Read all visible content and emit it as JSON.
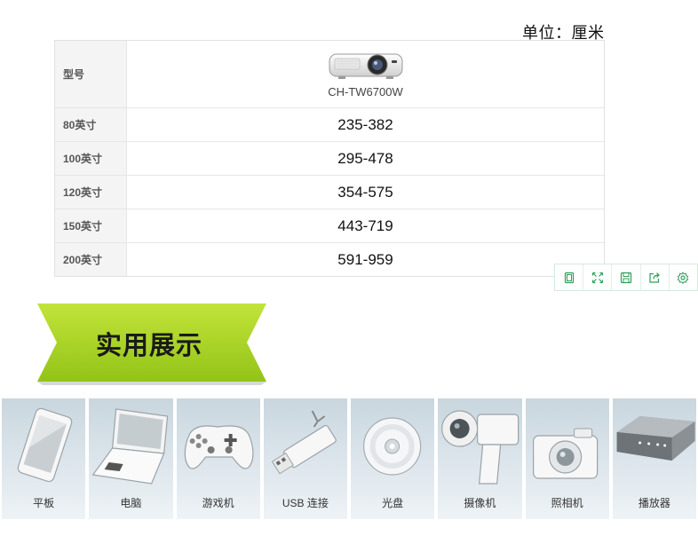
{
  "unit_label": "单位：厘米",
  "table": {
    "header_label": "型号",
    "model_name": "CH-TW6700W",
    "rows": [
      {
        "size": "80英寸",
        "value": "235-382"
      },
      {
        "size": "100英寸",
        "value": "295-478"
      },
      {
        "size": "120英寸",
        "value": "354-575"
      },
      {
        "size": "150英寸",
        "value": "443-719"
      },
      {
        "size": "200英寸",
        "value": "591-959"
      }
    ]
  },
  "toolbar": {
    "icons": [
      "page-icon",
      "fullscreen-icon",
      "save-icon",
      "share-icon",
      "settings-icon"
    ],
    "accent": "#2f9e5a"
  },
  "banner": {
    "title": "实用展示",
    "color": "#a8d21f"
  },
  "devices": [
    {
      "label": "平板",
      "icon": "tablet-icon"
    },
    {
      "label": "电脑",
      "icon": "laptop-icon"
    },
    {
      "label": "游戏机",
      "icon": "gamepad-icon"
    },
    {
      "label": "USB 连接",
      "icon": "usb-icon"
    },
    {
      "label": "光盘",
      "icon": "disc-icon"
    },
    {
      "label": "摄像机",
      "icon": "camcorder-icon"
    },
    {
      "label": "照相机",
      "icon": "camera-icon"
    },
    {
      "label": "播放器",
      "icon": "player-icon"
    }
  ]
}
